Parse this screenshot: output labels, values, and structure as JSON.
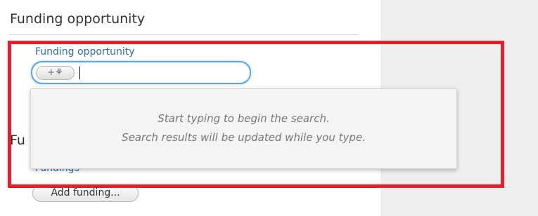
{
  "section": {
    "title": "Funding opportunity",
    "title_2": "Fu"
  },
  "field": {
    "label": "Funding opportunity",
    "lookup_icon": "+⚘",
    "value": ""
  },
  "popup": {
    "line1": "Start typing to begin the search.",
    "line2": "Search results will be updated while you type."
  },
  "fundings": {
    "label": "Fundings",
    "required_mark": "*",
    "add_button_label": "Add funding..."
  },
  "colors": {
    "highlight": "#e81e2c",
    "label": "#2f6ea5",
    "focus_border": "#5aa6e8"
  }
}
